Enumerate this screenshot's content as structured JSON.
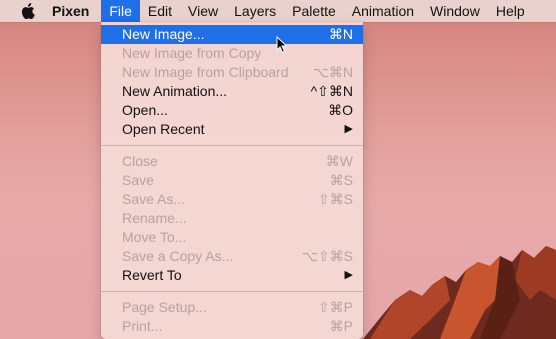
{
  "menubar": {
    "apple_icon": "apple-logo-icon",
    "app_name": "Pixen",
    "items": [
      "File",
      "Edit",
      "View",
      "Layers",
      "Palette",
      "Animation",
      "Window",
      "Help"
    ]
  },
  "file_menu": {
    "items": [
      {
        "label": "New Image...",
        "shortcut": "⌘N",
        "state": "highlighted"
      },
      {
        "label": "New Image from Copy",
        "shortcut": "",
        "state": "disabled"
      },
      {
        "label": "New Image from Clipboard",
        "shortcut": "⌥⌘N",
        "state": "disabled"
      },
      {
        "label": "New Animation...",
        "shortcut": "^⇧⌘N",
        "state": "enabled"
      },
      {
        "label": "Open...",
        "shortcut": "⌘O",
        "state": "enabled"
      },
      {
        "label": "Open Recent",
        "shortcut": "▶",
        "state": "enabled",
        "submenu": true
      },
      {
        "label": "Close",
        "shortcut": "⌘W",
        "state": "disabled"
      },
      {
        "label": "Save",
        "shortcut": "⌘S",
        "state": "disabled"
      },
      {
        "label": "Save As...",
        "shortcut": "⇧⌘S",
        "state": "disabled"
      },
      {
        "label": "Rename...",
        "shortcut": "",
        "state": "disabled"
      },
      {
        "label": "Move To...",
        "shortcut": "",
        "state": "disabled"
      },
      {
        "label": "Save a Copy As...",
        "shortcut": "⌥⇧⌘S",
        "state": "disabled"
      },
      {
        "label": "Revert To",
        "shortcut": "▶",
        "state": "enabled",
        "submenu": true
      },
      {
        "label": "Page Setup...",
        "shortcut": "⇧⌘P",
        "state": "disabled"
      },
      {
        "label": "Print...",
        "shortcut": "⌘P",
        "state": "disabled"
      }
    ]
  },
  "colors": {
    "highlight": "#1f6fe8",
    "disabled_text": "#b4a3a2"
  },
  "cursor_icon": "arrow-cursor-icon"
}
